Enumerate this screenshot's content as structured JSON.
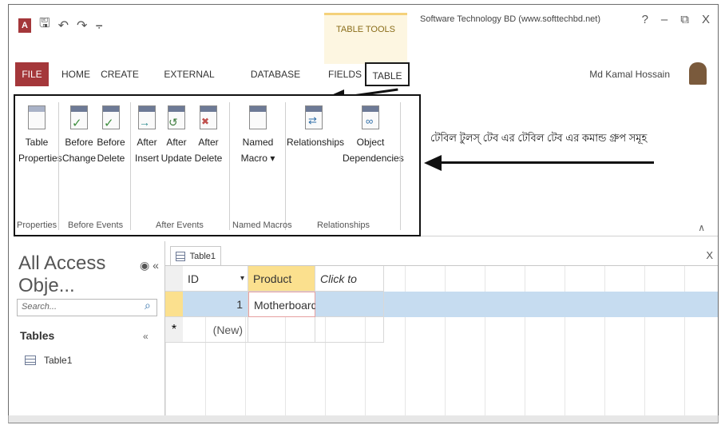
{
  "app": {
    "title": "Software Technology BD (www.softtechbd.net)",
    "contextual_group": "TABLE TOOLS",
    "user": "Md Kamal Hossain",
    "window_buttons": [
      "?",
      "–",
      "⧉",
      "X"
    ]
  },
  "qat": {
    "logo": "A",
    "undo": "↶",
    "redo": "↷",
    "customize": "⨪"
  },
  "tabs": [
    "FILE",
    "HOME",
    "CREATE",
    "EXTERNAL DATA",
    "DATABASE TOOLS",
    "FIELDS",
    "TABLE"
  ],
  "ribbon": {
    "buttons": [
      {
        "l1": "Table",
        "l2": "Properties"
      },
      {
        "l1": "Before",
        "l2": "Change"
      },
      {
        "l1": "Before",
        "l2": "Delete"
      },
      {
        "l1": "After",
        "l2": "Insert"
      },
      {
        "l1": "After",
        "l2": "Update"
      },
      {
        "l1": "After",
        "l2": "Delete"
      },
      {
        "l1": "Named",
        "l2": "Macro ▾"
      },
      {
        "l1": "Relationships",
        "l2": ""
      },
      {
        "l1": "Object",
        "l2": "Dependencies"
      }
    ],
    "groups": [
      "Properties",
      "Before Events",
      "After Events",
      "Named Macros",
      "Relationships"
    ]
  },
  "annotation": "টেবিল টুলস্ টেব এর টেবিল টেব এর কমান্ড গ্রুপ সমূহ",
  "nav": {
    "title": "All Access Obje...",
    "search_placeholder": "Search...",
    "section": "Tables",
    "items": [
      "Table1"
    ]
  },
  "document": {
    "tab": "Table1",
    "columns": [
      "ID",
      "Product Nan",
      "Click to Add"
    ],
    "rows": [
      {
        "id": "1",
        "product": "Motherboard"
      },
      {
        "id": "(New)",
        "product": ""
      }
    ],
    "new_marker": "*"
  },
  "colors": {
    "file_tab": "#a4373a",
    "selected_header": "#fbe08e",
    "selected_row": "#c6dcf0"
  }
}
